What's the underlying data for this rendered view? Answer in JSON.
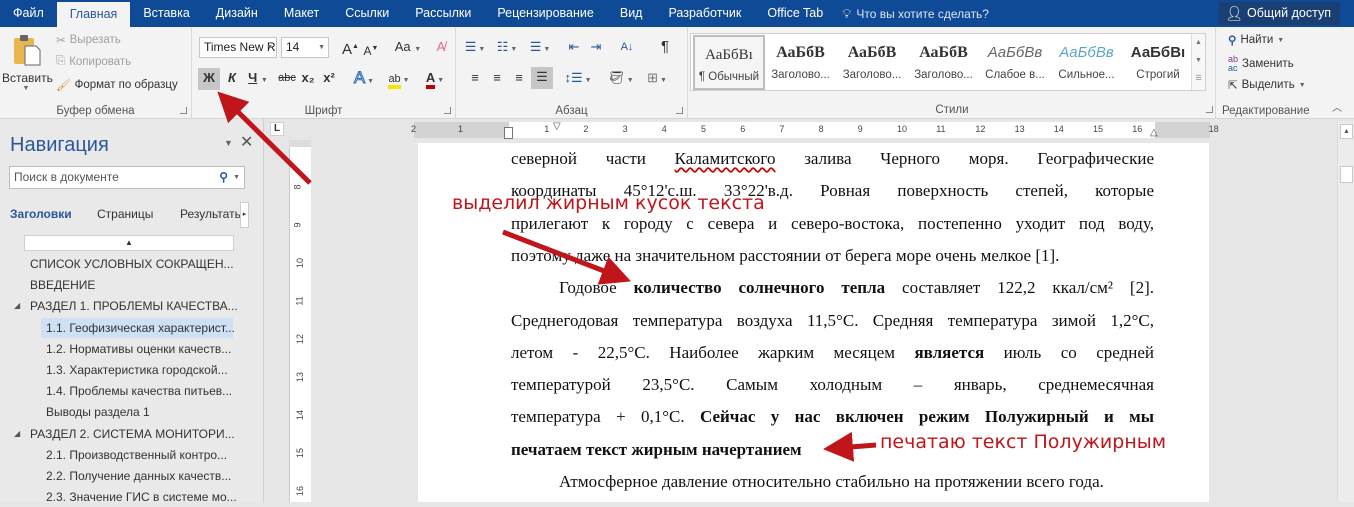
{
  "tabs": [
    {
      "label": "Файл"
    },
    {
      "label": "Главная",
      "active": true
    },
    {
      "label": "Вставка"
    },
    {
      "label": "Дизайн"
    },
    {
      "label": "Макет"
    },
    {
      "label": "Ссылки"
    },
    {
      "label": "Рассылки"
    },
    {
      "label": "Рецензирование"
    },
    {
      "label": "Вид"
    },
    {
      "label": "Разработчик"
    },
    {
      "label": "Office Tab"
    }
  ],
  "tell_me": {
    "icon": "lightbulb-icon",
    "placeholder": "Что вы хотите сделать?"
  },
  "share": {
    "icon": "person-add-icon",
    "label": "Общий доступ"
  },
  "ribbon": {
    "clipboard": {
      "label": "Буфер обмена",
      "paste": "Вставить",
      "cut": "Вырезать",
      "copy": "Копировать",
      "format_painter": "Формат по образцу"
    },
    "font": {
      "label": "Шрифт",
      "font_name": "Times New R",
      "font_size": "14",
      "grow": "A",
      "shrink": "A",
      "case": "Aa",
      "bold": "Ж",
      "italic": "К",
      "underline": "Ч",
      "strike": "abc",
      "subscript": "x₂",
      "superscript": "x²",
      "text_effects": "A",
      "highlight": "ab",
      "font_color": "A",
      "bold_active": true,
      "highlight_color": "#f5e500",
      "font_color_value": "#c00000"
    },
    "paragraph": {
      "label": "Абзац",
      "justify_active": true,
      "pilcrow": "¶",
      "sort": "А↓"
    },
    "styles": {
      "label": "Стили",
      "items": [
        {
          "sample": "АаБбВı",
          "name": "¶ Обычный",
          "selected": true
        },
        {
          "sample": "АаБбВ",
          "name": "Заголово..."
        },
        {
          "sample": "АаБбВ",
          "name": "Заголово..."
        },
        {
          "sample": "АаБбВ",
          "name": "Заголово..."
        },
        {
          "sample": "АаБбВв",
          "name": "Слабое в..."
        },
        {
          "sample": "АаБбВв",
          "name": "Сильное..."
        },
        {
          "sample": "АаБбВı",
          "name": "Строгий"
        }
      ]
    },
    "editing": {
      "label": "Редактирование",
      "find": "Найти",
      "replace": "Заменить",
      "select": "Выделить"
    }
  },
  "navigation": {
    "title": "Навигация",
    "search_placeholder": "Поиск в документе",
    "tabs": [
      "Заголовки",
      "Страницы",
      "Результать"
    ],
    "items": [
      {
        "text": "СПИСОК УСЛОВНЫХ СОКРАЩЕН...",
        "level": 1
      },
      {
        "text": "ВВЕДЕНИЕ",
        "level": 1
      },
      {
        "text": "РАЗДЕЛ 1.  ПРОБЛЕМЫ КАЧЕСТВА...",
        "level": 1,
        "expanded": true
      },
      {
        "text": "1.1. Геофизическая характерист...",
        "level": 2,
        "selected": true
      },
      {
        "text": "1.2. Нормативы оценки качеств...",
        "level": 2
      },
      {
        "text": "1.3. Характеристика городской...",
        "level": 2
      },
      {
        "text": "1.4. Проблемы качества питьев...",
        "level": 2
      },
      {
        "text": "Выводы раздела 1",
        "level": 2
      },
      {
        "text": "РАЗДЕЛ 2. СИСТЕМА МОНИТОРИ...",
        "level": 1,
        "expanded": true
      },
      {
        "text": "2.1. Производственный контро...",
        "level": 2
      },
      {
        "text": "2.2. Получение данных качеств...",
        "level": 2
      },
      {
        "text": "2.3. Значение ГИС в системе мо...",
        "level": 2
      }
    ]
  },
  "ruler": {
    "horizontal": [
      "2",
      "1",
      "1",
      "2",
      "3",
      "4",
      "5",
      "6",
      "7",
      "8",
      "9",
      "10",
      "11",
      "12",
      "13",
      "14",
      "15",
      "16",
      "18"
    ],
    "vertical": [
      "8",
      "9",
      "10",
      "11",
      "12",
      "13",
      "14",
      "15",
      "16"
    ]
  },
  "document": {
    "lines": [
      {
        "segments": [
          {
            "t": "северной части "
          },
          {
            "t": "Каламитского",
            "spell": true
          },
          {
            "t": " залива Черного моря. Географические"
          }
        ]
      },
      {
        "segments": [
          {
            "t": "координаты 45°12'с.ш. 33°22'в.д. Ровная поверхность степей, которые"
          }
        ]
      },
      {
        "segments": [
          {
            "t": "прилегают к городу с севера и северо-востока, постепенно уходит под воду,"
          }
        ]
      },
      {
        "segments": [
          {
            "t": "поэтому даже на значительном расстоянии от берега море очень мелкое [1]."
          }
        ],
        "last": true
      },
      {
        "indent": true,
        "segments": [
          {
            "t": "Годовое "
          },
          {
            "t": "количество солнечного тепла",
            "b": true
          },
          {
            "t": " составляет 122,2 ккал/см² [2]."
          }
        ]
      },
      {
        "segments": [
          {
            "t": "Среднегодовая температура воздуха 11,5°С. Средняя температура зимой 1,2°С,"
          }
        ]
      },
      {
        "segments": [
          {
            "t": "летом - 22,5°С. Наиболее жарким месяцем "
          },
          {
            "t": "является",
            "b": true
          },
          {
            "t": " июль со средней"
          }
        ]
      },
      {
        "segments": [
          {
            "t": "температурой 23,5°С. Самым холодным – январь, среднемесячная"
          }
        ]
      },
      {
        "segments": [
          {
            "t": "температура + 0,1°С. "
          },
          {
            "t": "Сейчас у нас включен режим Полужирный и мы",
            "b": true
          }
        ]
      },
      {
        "segments": [
          {
            "t": "печатаем текст жирным начертанием",
            "b": true
          }
        ],
        "last": true
      },
      {
        "indent": true,
        "segments": [
          {
            "t": "Атмосферное давление относительно стабильно на протяжении всего года."
          }
        ],
        "last": true
      }
    ]
  },
  "annotations": {
    "top": "выделил жирным кусок текста",
    "bottom": "печатаю текст Полужирным",
    "color": "#c0151b"
  },
  "colors": {
    "tabbar": "#0f4a96",
    "accent": "#2b579a"
  }
}
